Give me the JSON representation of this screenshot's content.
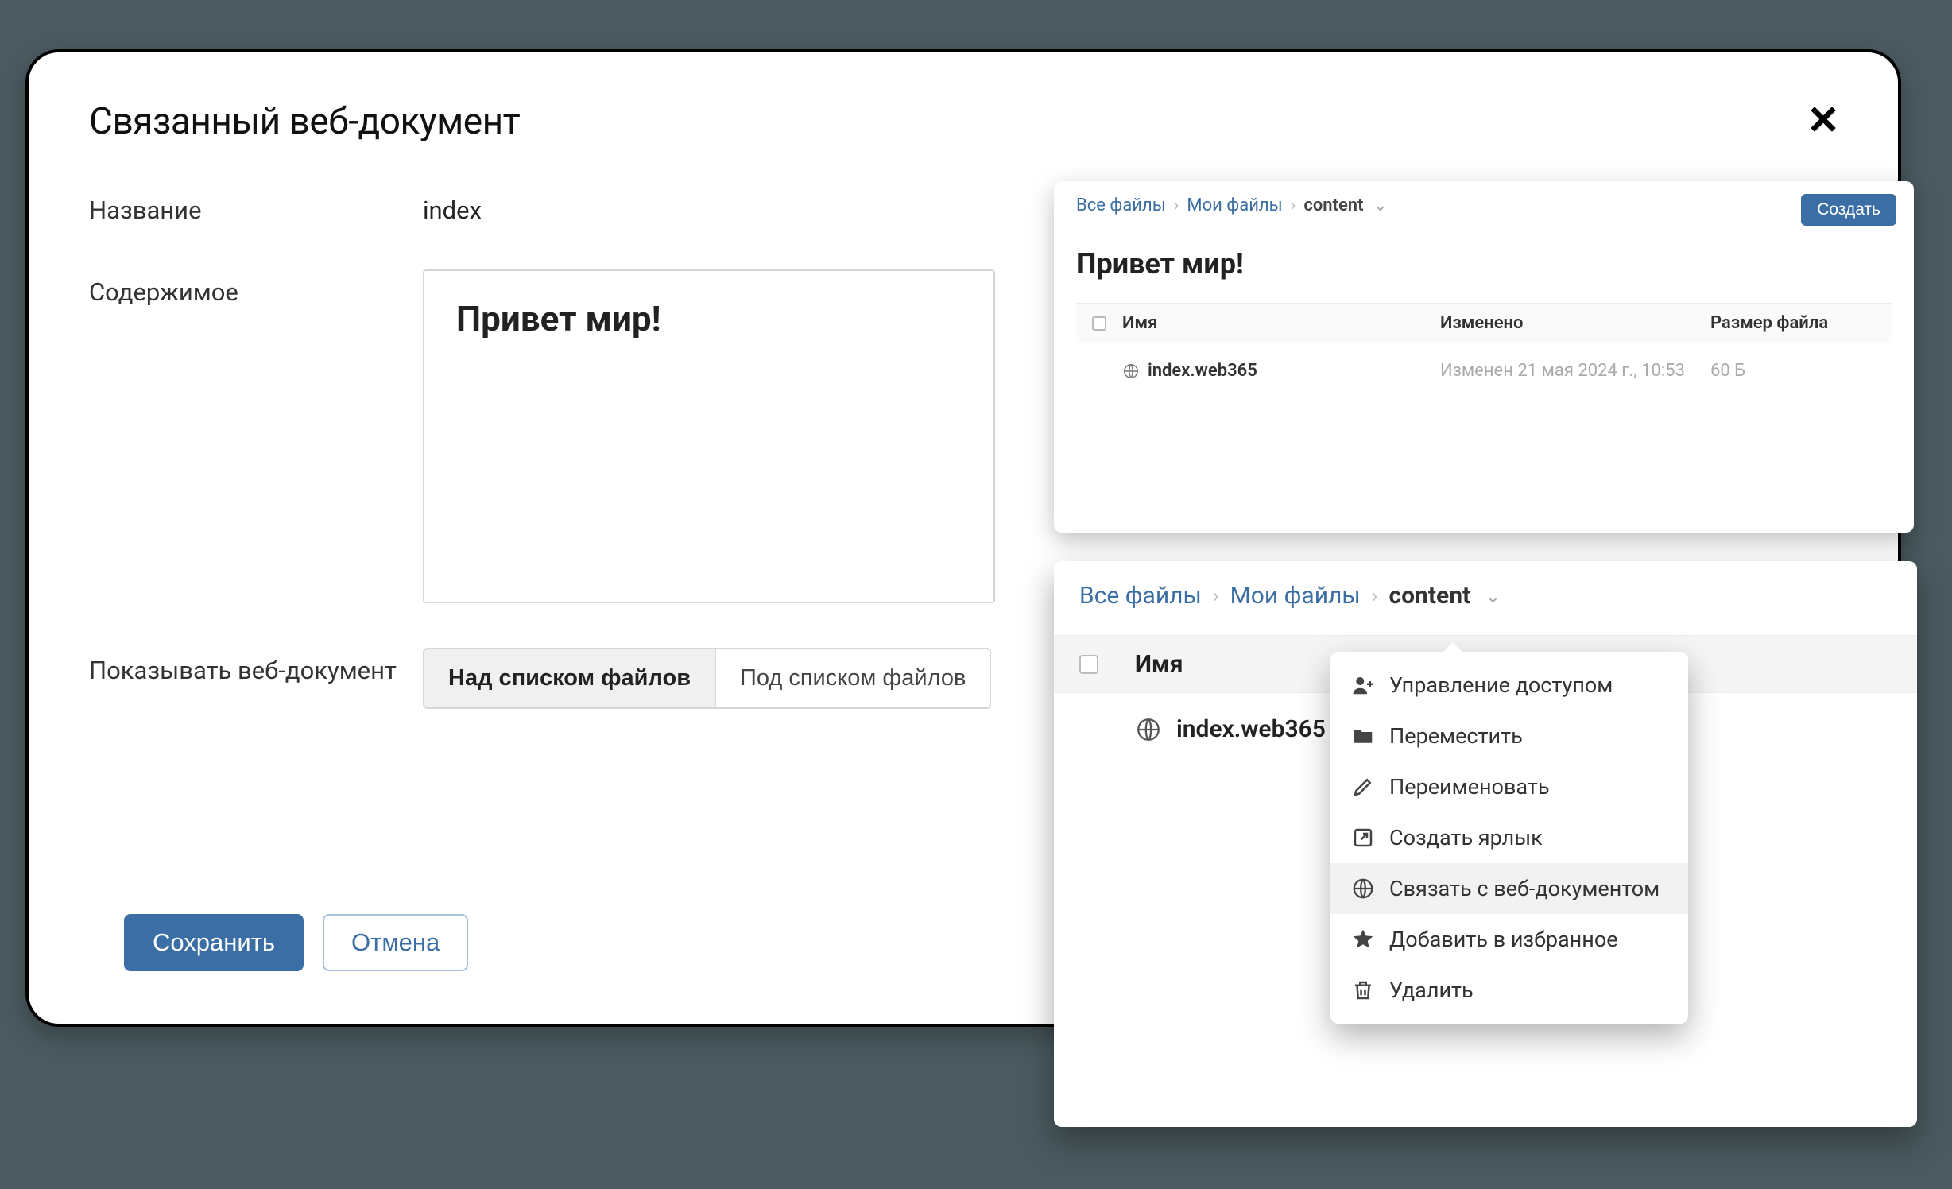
{
  "dialog": {
    "title": "Связанный веб-документ",
    "fields": {
      "name_label": "Название",
      "name_value": "index",
      "content_label": "Содержимое",
      "content_value": "Привет мир!",
      "position_label": "Показывать веб-документ"
    },
    "segmented": {
      "above": "Над списком файлов",
      "below": "Под списком файлов"
    },
    "buttons": {
      "save": "Сохранить",
      "cancel": "Отмена"
    }
  },
  "browser_small": {
    "breadcrumbs": [
      "Все файлы",
      "Мои файлы",
      "content"
    ],
    "create_button": "Создать",
    "folder_title": "Привет мир!",
    "columns": {
      "name": "Имя",
      "modified": "Изменено",
      "size": "Размер файла"
    },
    "rows": [
      {
        "name": "index.web365",
        "modified": "Изменен 21 мая 2024 г., 10:53",
        "size": "60 Б"
      }
    ]
  },
  "browser_large": {
    "breadcrumbs": [
      "Все файлы",
      "Мои файлы",
      "content"
    ],
    "columns": {
      "name": "Имя"
    },
    "rows": [
      {
        "name": "index.web365"
      }
    ]
  },
  "context_menu": {
    "items": [
      {
        "icon": "user-plus-icon",
        "label": "Управление доступом"
      },
      {
        "icon": "folder-move-icon",
        "label": "Переместить"
      },
      {
        "icon": "pencil-icon",
        "label": "Переименовать"
      },
      {
        "icon": "shortcut-icon",
        "label": "Создать ярлык"
      },
      {
        "icon": "web-doc-icon",
        "label": "Связать с веб-документом",
        "highlight": true
      },
      {
        "icon": "star-icon",
        "label": "Добавить в избранное"
      },
      {
        "icon": "trash-icon",
        "label": "Удалить"
      }
    ]
  }
}
